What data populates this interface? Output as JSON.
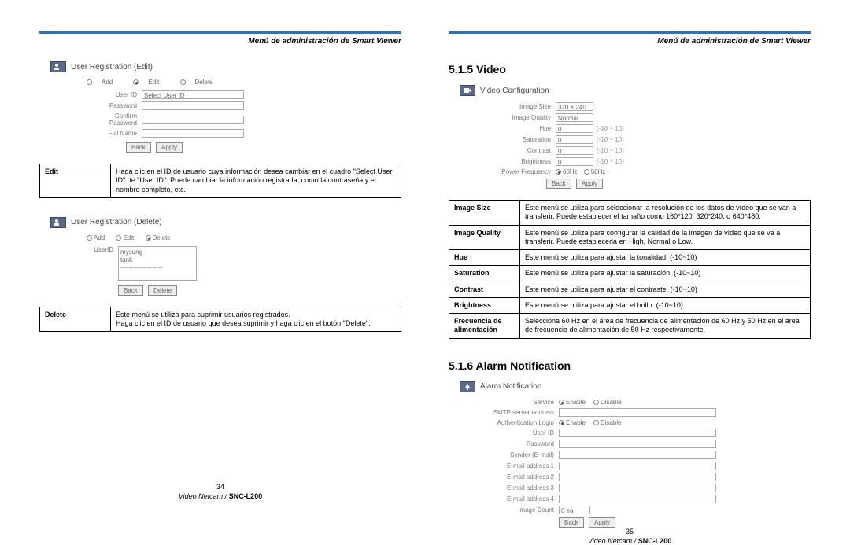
{
  "header": "Menú de administración de Smart Viewer",
  "leftPage": {
    "sub1": "User Registration (Edit)",
    "form1": {
      "radios": [
        "Add",
        "Edit",
        "Delete"
      ],
      "rows": [
        {
          "label": "User ID",
          "value": "Select User ID"
        },
        {
          "label": "Password",
          "value": ""
        },
        {
          "label": "Confirm Password",
          "value": ""
        },
        {
          "label": "Full Name",
          "value": ""
        }
      ],
      "btns": [
        "Back",
        "Apply"
      ]
    },
    "table1": {
      "term": "Edit",
      "desc": "Haga clic en el ID de usuario cuya información desea cambiar en el cuadro \"Select User ID\" de \"User ID\". Puede cambiar la información registrada, como la contraseña y el nombre completo, etc."
    },
    "sub2": "User Registration (Delete)",
    "form2": {
      "radios": [
        "Add",
        "Edit",
        "Delete"
      ],
      "userLabel": "UserID",
      "listItems": "mysung\ntank\n--------------------",
      "btns": [
        "Back",
        "Delete"
      ]
    },
    "table2": {
      "term": "Delete",
      "desc": "Este menú se utiliza para suprimir usuarios registrados.\nHaga clic en el ID de usuario que desea suprimir y haga clic en el botón \"Delete\"."
    },
    "pageNum": "34",
    "footerModel": "Video Netcam /",
    "footerBold": "SNC-L200"
  },
  "rightPage": {
    "h1": "5.1.5 Video",
    "sub1": "Video Configuration",
    "vconfig": {
      "rows": [
        {
          "label": "Image Size",
          "value": "320 × 240",
          "range": ""
        },
        {
          "label": "Image Quality",
          "value": "Normal",
          "range": ""
        },
        {
          "label": "Hue",
          "value": "0",
          "range": "(-10 ~ 10)"
        },
        {
          "label": "Saturation",
          "value": "0",
          "range": "(-10 ~ 10)"
        },
        {
          "label": "Contrast",
          "value": "0",
          "range": "(-10 ~ 10)"
        },
        {
          "label": "Brightness",
          "value": "0",
          "range": "(-10 ~ 10)"
        }
      ],
      "powerLabel": "Power Frequency",
      "powerOptions": [
        "60Hz",
        "50Hz"
      ],
      "btns": [
        "Back",
        "Apply"
      ]
    },
    "videoTable": [
      {
        "term": "Image Size",
        "desc": "Este menú se utiliza para seleccionar la resolución de los datos de vídeo que se van a transferir. Puede establecer el tamaño como 160*120, 320*240, o 640*480."
      },
      {
        "term": "Image Quality",
        "desc": "Este menú se utiliza para configurar la calidad de la imagen de vídeo que se va a transferir. Puede establecerla en High, Normal o Low."
      },
      {
        "term": "Hue",
        "desc": "Este menú se utiliza para ajustar la tonalidad. (-10~10)"
      },
      {
        "term": "Saturation",
        "desc": "Este menú se utiliza para ajustar la saturación. (-10~10)"
      },
      {
        "term": "Contrast",
        "desc": "Este menú se utiliza para ajustar el contraste. (-10~10)"
      },
      {
        "term": "Brightness",
        "desc": "Este menú se utiliza para ajustar el brillo. (-10~10)"
      },
      {
        "term": "Frecuencia de alimentación",
        "desc": "Selecciona 60 Hz en el área de frecuencia de alimentación de 60 Hz y 50 Hz en el área de frecuencia de alimentación de 50 Hz respectivamente."
      }
    ],
    "h2": "5.1.6 Alarm Notification",
    "sub2": "Alarm Notification",
    "aform": {
      "rows": [
        {
          "label": "Service",
          "type": "radio",
          "options": [
            "Enable",
            "Disable"
          ]
        },
        {
          "label": "SMTP server address",
          "type": "text"
        },
        {
          "label": "Authentication Login",
          "type": "radio",
          "options": [
            "Enable",
            "Disable"
          ]
        },
        {
          "label": "User ID",
          "type": "text"
        },
        {
          "label": "Password",
          "type": "text"
        },
        {
          "label": "Sender (E-mail)",
          "type": "text"
        },
        {
          "label": "E-mail address 1",
          "type": "text"
        },
        {
          "label": "E-mail address 2",
          "type": "text"
        },
        {
          "label": "E-mail address 3",
          "type": "text"
        },
        {
          "label": "E-mail address 4",
          "type": "text"
        },
        {
          "label": "Image Count",
          "type": "short",
          "value": "0 ea"
        }
      ],
      "btns": [
        "Back",
        "Apply"
      ]
    },
    "pageNum": "35",
    "footerModel": "Video Netcam /",
    "footerBold": "SNC-L200"
  }
}
